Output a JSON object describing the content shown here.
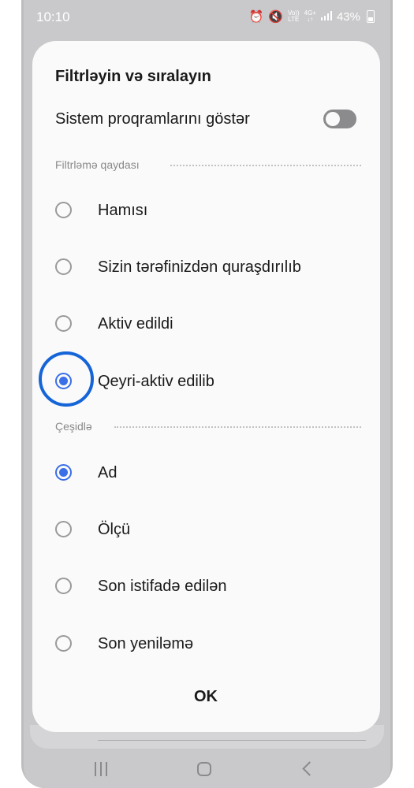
{
  "status_bar": {
    "time": "10:10",
    "volte_top": "Vo))",
    "volte_bottom": "LTE",
    "network_top": "4G+",
    "network_bottom": "↓↑",
    "battery": "43%"
  },
  "dialog": {
    "title": "Filtrləyin və sıralayın",
    "show_system_apps": {
      "label": "Sistem proqramlarını göstər",
      "enabled": false
    },
    "filter_section": {
      "header": "Filtrləmə qaydası",
      "options": [
        {
          "label": "Hamısı",
          "selected": false
        },
        {
          "label": "Sizin tərəfinizdən quraşdırılıb",
          "selected": false
        },
        {
          "label": "Aktiv edildi",
          "selected": false
        },
        {
          "label": "Qeyri-aktiv edilib",
          "selected": true
        }
      ]
    },
    "sort_section": {
      "header": "Çeşidlə",
      "options": [
        {
          "label": "Ad",
          "selected": true
        },
        {
          "label": "Ölçü",
          "selected": false
        },
        {
          "label": "Son istifadə edilən",
          "selected": false
        },
        {
          "label": "Son yeniləmə",
          "selected": false
        }
      ]
    },
    "ok_label": "OK"
  },
  "colors": {
    "accent": "#3a6fe8",
    "highlight_ring": "#1565d8",
    "toggle_off": "#8b8b8d"
  }
}
